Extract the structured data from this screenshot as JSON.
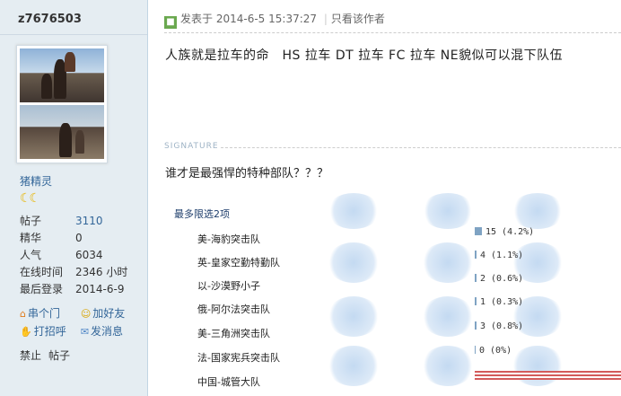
{
  "author": {
    "username": "z7676503",
    "nickname": "猪精灵",
    "stars_glyph": "☾☾",
    "stats": [
      {
        "label": "帖子",
        "value": "3110",
        "link": true
      },
      {
        "label": "精华",
        "value": "0",
        "link": false
      },
      {
        "label": "人气",
        "value": "6034",
        "link": false
      },
      {
        "label": "在线时间",
        "value": "2346 小时",
        "link": false
      },
      {
        "label": "最后登录",
        "value": "2014-6-9",
        "link": false
      }
    ],
    "actions": [
      {
        "label": "串个门",
        "icon": "house-icon"
      },
      {
        "label": "加好友",
        "icon": "add-friend-icon"
      },
      {
        "label": "打招呼",
        "icon": "greet-icon"
      },
      {
        "label": "发消息",
        "icon": "message-icon"
      }
    ],
    "bottom_links": [
      "禁止",
      "帖子"
    ]
  },
  "post": {
    "posted_prefix": "发表于",
    "posted_time": "2014-6-5 15:37:27",
    "separator": "|",
    "only_author": "只看该作者",
    "body": "人族就是拉车的命　HS 拉车 DT 拉车 FC 拉车 NE貌似可以混下队伍"
  },
  "signature": {
    "label": "SIGNATURE",
    "poll_title": "谁才是最强悍的特种部队？？？",
    "max_choice": "最多限选2项",
    "options": [
      {
        "label": "美-海豹突击队",
        "votes": 15,
        "percent": "4.2%",
        "display": "15 (4.2%)"
      },
      {
        "label": "英-皇家空勤特勤队",
        "votes": 4,
        "percent": "1.1%",
        "display": "4 (1.1%)"
      },
      {
        "label": "以-沙漠野小子",
        "votes": 2,
        "percent": "0.6%",
        "display": "2 (0.6%)"
      },
      {
        "label": "俄-阿尔法突击队",
        "votes": 1,
        "percent": "0.3%",
        "display": "1 (0.3%)"
      },
      {
        "label": "美-三角洲突击队",
        "votes": 3,
        "percent": "0.8%",
        "display": "3 (0.8%)"
      },
      {
        "label": "法-国家宪兵突击队",
        "votes": 0,
        "percent": "0%",
        "display": "0 (0%)"
      },
      {
        "label": "中国-城管大队",
        "votes": null,
        "percent": "",
        "display": ""
      }
    ]
  },
  "colors": {
    "sidebar_bg": "#e5edf2",
    "link": "#336699",
    "poll_bar": "#7fa3c3",
    "stripe": "#d35b5b"
  }
}
